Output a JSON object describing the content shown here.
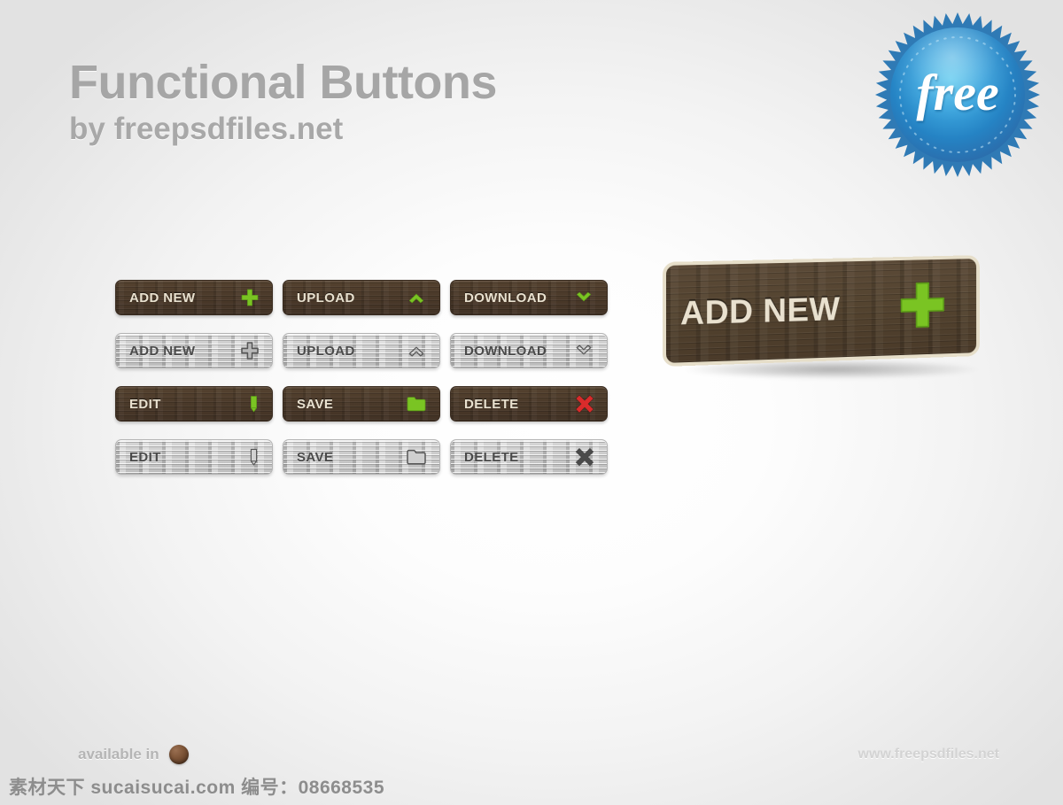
{
  "header": {
    "title": "Functional Buttons",
    "subtitle": "by freepsdfiles.net"
  },
  "badge": {
    "label": "free",
    "icon": "starburst-badge",
    "color_outer": "#2f7ab5",
    "color_inner_light": "#4fc0e8",
    "color_inner_dark": "#1f6aad"
  },
  "colors": {
    "wood_dark": "#4b3a2a",
    "wood_light": "#cacaca",
    "text_cream": "#e9e1cf",
    "text_dark": "#4a4a4a",
    "accent_green": "#7ac423",
    "accent_red": "#d92b2b",
    "accent_gray": "#4a4a4a",
    "border_cream": "#e6dec9",
    "background": "#e9e9e9"
  },
  "grid": {
    "rows": [
      {
        "style": "dark",
        "buttons": [
          {
            "label": "ADD NEW",
            "icon": "plus-icon",
            "icon_color": "#7ac423"
          },
          {
            "label": "UPLOAD",
            "icon": "chevron-up-icon",
            "icon_color": "#7ac423"
          },
          {
            "label": "DOWNLOAD",
            "icon": "chevron-down-icon",
            "icon_color": "#7ac423"
          }
        ]
      },
      {
        "style": "light",
        "buttons": [
          {
            "label": "ADD NEW",
            "icon": "plus-outline-icon",
            "icon_color": "#565656"
          },
          {
            "label": "UPLOAD",
            "icon": "chevron-up-outline-icon",
            "icon_color": "#565656"
          },
          {
            "label": "DOWNLOAD",
            "icon": "chevron-down-outline-icon",
            "icon_color": "#565656"
          }
        ]
      },
      {
        "style": "dark",
        "buttons": [
          {
            "label": "EDIT",
            "icon": "pencil-icon",
            "icon_color": "#7ac423"
          },
          {
            "label": "SAVE",
            "icon": "folder-icon",
            "icon_color": "#7ac423"
          },
          {
            "label": "DELETE",
            "icon": "cross-icon",
            "icon_color": "#d92b2b"
          }
        ]
      },
      {
        "style": "light",
        "buttons": [
          {
            "label": "EDIT",
            "icon": "pencil-outline-icon",
            "icon_color": "#565656"
          },
          {
            "label": "SAVE",
            "icon": "folder-outline-icon",
            "icon_color": "#565656"
          },
          {
            "label": "DELETE",
            "icon": "cross-icon",
            "icon_color": "#4a4a4a"
          }
        ]
      }
    ]
  },
  "big_button": {
    "label": "ADD NEW",
    "icon": "plus-icon",
    "icon_color": "#7ac423"
  },
  "footer": {
    "available_text": "available in",
    "available_icon": "psd-ball-icon",
    "site": "www.freepsdfiles.net",
    "watermark": "素材天下 sucaisucai.com 编号：08668535"
  }
}
